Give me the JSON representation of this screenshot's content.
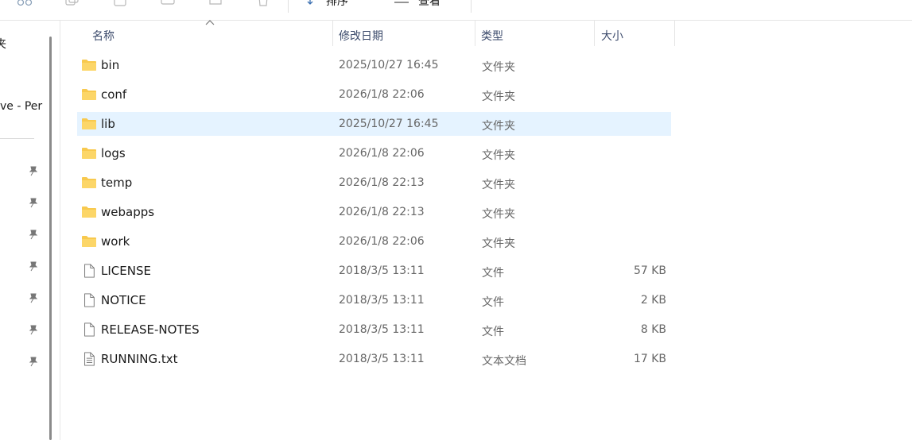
{
  "toolbar": {
    "sort_label": "排序",
    "view_label": "查看",
    "icons": [
      "cut-icon",
      "copy-icon",
      "paste-icon",
      "rename-icon",
      "share-icon",
      "delete-icon",
      "sort-icon",
      "view-icon"
    ]
  },
  "nav": {
    "partial_item_1": "夹",
    "partial_item_2": "ve - Per",
    "pinned_count": 7
  },
  "columns": {
    "name": "名称",
    "modified": "修改日期",
    "type": "类型",
    "size": "大小"
  },
  "files": [
    {
      "name": "bin",
      "modified": "2025/10/27 16:45",
      "type": "文件夹",
      "size": "",
      "kind": "folder"
    },
    {
      "name": "conf",
      "modified": "2026/1/8 22:06",
      "type": "文件夹",
      "size": "",
      "kind": "folder"
    },
    {
      "name": "lib",
      "modified": "2025/10/27 16:45",
      "type": "文件夹",
      "size": "",
      "kind": "folder",
      "selected": true
    },
    {
      "name": "logs",
      "modified": "2026/1/8 22:06",
      "type": "文件夹",
      "size": "",
      "kind": "folder"
    },
    {
      "name": "temp",
      "modified": "2026/1/8 22:13",
      "type": "文件夹",
      "size": "",
      "kind": "folder"
    },
    {
      "name": "webapps",
      "modified": "2026/1/8 22:13",
      "type": "文件夹",
      "size": "",
      "kind": "folder"
    },
    {
      "name": "work",
      "modified": "2026/1/8 22:06",
      "type": "文件夹",
      "size": "",
      "kind": "folder"
    },
    {
      "name": "LICENSE",
      "modified": "2018/3/5 13:11",
      "type": "文件",
      "size": "57 KB",
      "kind": "file"
    },
    {
      "name": "NOTICE",
      "modified": "2018/3/5 13:11",
      "type": "文件",
      "size": "2 KB",
      "kind": "file"
    },
    {
      "name": "RELEASE-NOTES",
      "modified": "2018/3/5 13:11",
      "type": "文件",
      "size": "8 KB",
      "kind": "file"
    },
    {
      "name": "RUNNING.txt",
      "modified": "2018/3/5 13:11",
      "type": "文本文档",
      "size": "17 KB",
      "kind": "text"
    }
  ],
  "colors": {
    "selected_row": "#e5f3ff",
    "folder": "#f8c94e",
    "header_text": "#3b4a6b",
    "secondary_text": "#666666"
  }
}
